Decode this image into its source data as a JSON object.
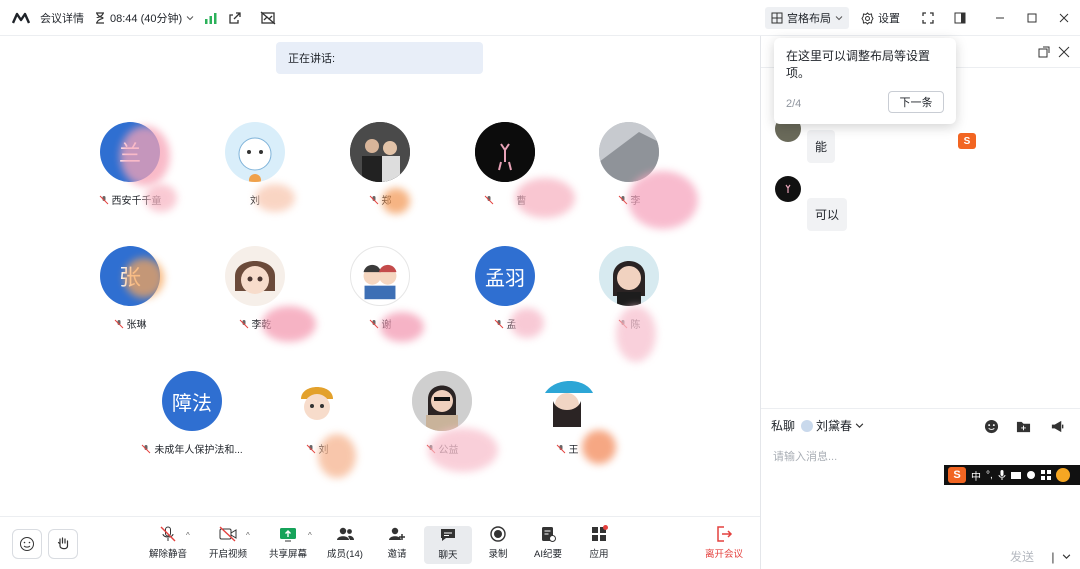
{
  "titlebar": {
    "meeting_details": "会议详情",
    "time": "08:44 (40分钟)",
    "layout_label": "宫格布局",
    "settings_label": "设置"
  },
  "stage": {
    "speaking_label": "正在讲话:",
    "participants": [
      {
        "name": "西安千千童",
        "avatar_text": "兰"
      },
      {
        "name": "刘",
        "avatar_text": ""
      },
      {
        "name": "郑",
        "avatar_text": ""
      },
      {
        "name": "曹",
        "avatar_text": ""
      },
      {
        "name": "李",
        "avatar_text": ""
      },
      {
        "name": "张琳",
        "avatar_text": "张"
      },
      {
        "name": "李乾",
        "avatar_text": ""
      },
      {
        "name": "谢",
        "avatar_text": ""
      },
      {
        "name": "孟",
        "avatar_text": "孟羽"
      },
      {
        "name": "陈",
        "avatar_text": ""
      },
      {
        "name": "未成年人保护法和...",
        "avatar_text": "障法"
      },
      {
        "name": "刘",
        "avatar_text": ""
      },
      {
        "name": "公益",
        "avatar_text": ""
      },
      {
        "name": "王",
        "avatar_text": ""
      }
    ]
  },
  "toolbar": {
    "unmute": "解除静音",
    "start_video": "开启视频",
    "share_screen": "共享屏幕",
    "members": "成员(14)",
    "invite": "邀请",
    "chat": "聊天",
    "record": "录制",
    "ai_minutes": "AI纪要",
    "apps": "应用",
    "leave": "离开会议"
  },
  "chat": {
    "tooltip_text": "在这里可以调整布局等设置项。",
    "tooltip_step": "2/4",
    "tooltip_next": "下一条",
    "messages": [
      {
        "text": "能"
      },
      {
        "text": "可以"
      }
    ],
    "private_label": "私聊",
    "private_target": "刘黛春",
    "input_placeholder": "请输入消息...",
    "send_label": "发送",
    "ime_lang": "中"
  },
  "colors": {
    "accent_blue": "#2f6fd1",
    "leave_red": "#e4413e",
    "ime_orange": "#f26522"
  }
}
